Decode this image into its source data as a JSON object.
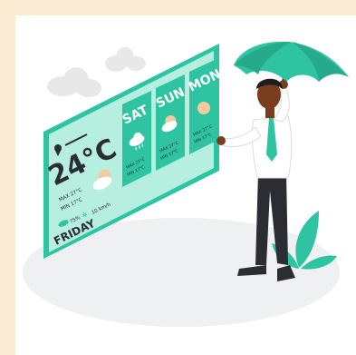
{
  "weather_widget": {
    "temperature": "24°C",
    "day": "FRIDAY",
    "max": "MAX 27°C",
    "min": "MIN 17°C",
    "humidity": "75%",
    "wind": "10 km/h",
    "forecast": [
      {
        "day": "SAT",
        "max": "MAX 27°C",
        "min": "MIN 17°C",
        "icon": "cloud-rain-icon"
      },
      {
        "day": "SUN",
        "max": "MAX 27°C",
        "min": "MIN 17°C",
        "icon": "partly-cloudy-icon"
      },
      {
        "day": "MON",
        "max": "MAX 27°C",
        "min": "MIN 17°C",
        "icon": "sun-icon"
      }
    ]
  },
  "colors": {
    "frame": "#fcebd3",
    "accent": "#2ec4a2",
    "panel_light": "#b6efe0",
    "suit": "#2b2d33",
    "shirt": "#ffffff",
    "skin": "#7a3e1f"
  }
}
